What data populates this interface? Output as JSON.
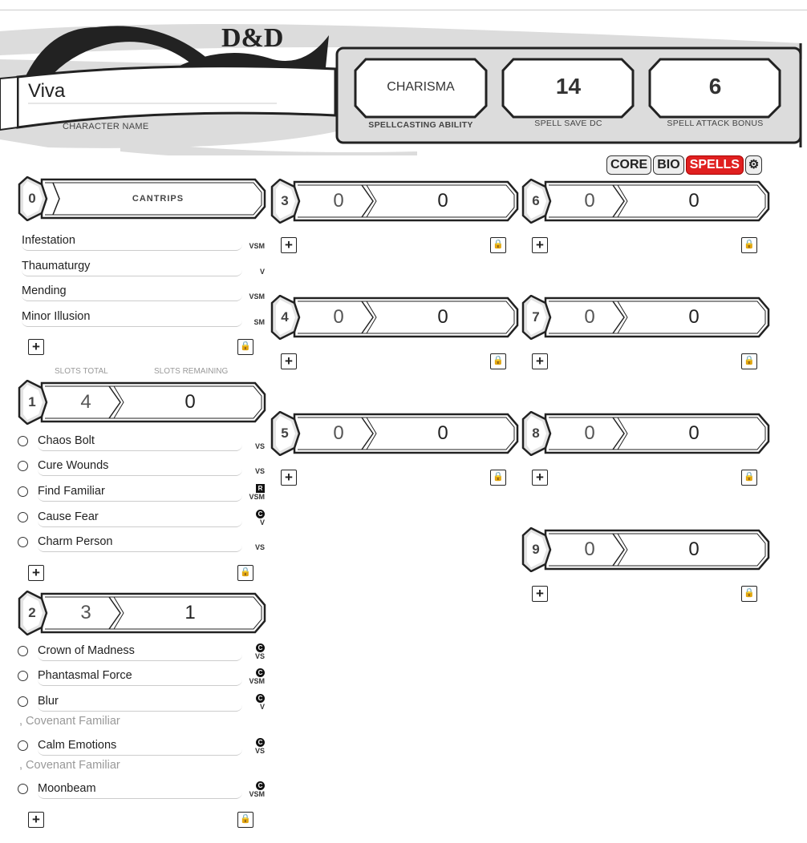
{
  "header": {
    "logo": "D&D",
    "character_name": "Viva",
    "character_name_label": "CHARACTER NAME",
    "spellcasting_ability": "CHARISMA",
    "spellcasting_ability_label": "SPELLCASTING ABILITY",
    "spell_save_dc": "14",
    "spell_save_dc_label": "SPELL SAVE DC",
    "spell_attack_bonus": "6",
    "spell_attack_bonus_label": "SPELL ATTACK BONUS"
  },
  "tabs": [
    {
      "label": "CORE"
    },
    {
      "label": "BIO"
    },
    {
      "label": "SPELLS",
      "active": true
    },
    {
      "label": "⚙",
      "icon": "gear-icon"
    }
  ],
  "colors": {
    "accent": "#e02020",
    "frame": "#333333",
    "panel": "#dddddd"
  },
  "slot_labels": {
    "total": "SLOTS TOTAL",
    "remaining": "SLOTS REMAINING"
  },
  "levels": [
    {
      "level": "0",
      "title": "CANTRIPS",
      "spells": [
        {
          "name": "Infestation",
          "comp": "VSM"
        },
        {
          "name": "Thaumaturgy",
          "comp": "V"
        },
        {
          "name": "Mending",
          "comp": "VSM"
        },
        {
          "name": "Minor Illusion",
          "comp": "SM"
        }
      ]
    },
    {
      "level": "1",
      "total": "4",
      "remaining": "0",
      "spells": [
        {
          "name": "Chaos Bolt",
          "comp": "VS"
        },
        {
          "name": "Cure Wounds",
          "comp": "VS"
        },
        {
          "name": "Find Familiar",
          "comp": "VSM",
          "ritual": "R"
        },
        {
          "name": "Cause Fear",
          "comp": "V",
          "conc": "C"
        },
        {
          "name": "Charm Person",
          "comp": "VS"
        }
      ]
    },
    {
      "level": "2",
      "total": "3",
      "remaining": "1",
      "spells": [
        {
          "name": "Crown of Madness",
          "comp": "VS",
          "conc": "C"
        },
        {
          "name": "Phantasmal Force",
          "comp": "VSM",
          "conc": "C"
        },
        {
          "name": "Blur",
          "comp": "V",
          "conc": "C",
          "note": ", Covenant Familiar"
        },
        {
          "name": "Calm Emotions",
          "comp": "VS",
          "conc": "C",
          "note": ", Covenant Familiar"
        },
        {
          "name": "Moonbeam",
          "comp": "VSM",
          "conc": "C"
        }
      ]
    },
    {
      "level": "3",
      "total": "0",
      "remaining": "0",
      "spells": []
    },
    {
      "level": "4",
      "total": "0",
      "remaining": "0",
      "spells": []
    },
    {
      "level": "5",
      "total": "0",
      "remaining": "0",
      "spells": []
    },
    {
      "level": "6",
      "total": "0",
      "remaining": "0",
      "spells": []
    },
    {
      "level": "7",
      "total": "0",
      "remaining": "0",
      "spells": []
    },
    {
      "level": "8",
      "total": "0",
      "remaining": "0",
      "spells": []
    },
    {
      "level": "9",
      "total": "0",
      "remaining": "0",
      "spells": []
    }
  ],
  "buttons": {
    "add": "+",
    "lock": "🔒"
  }
}
